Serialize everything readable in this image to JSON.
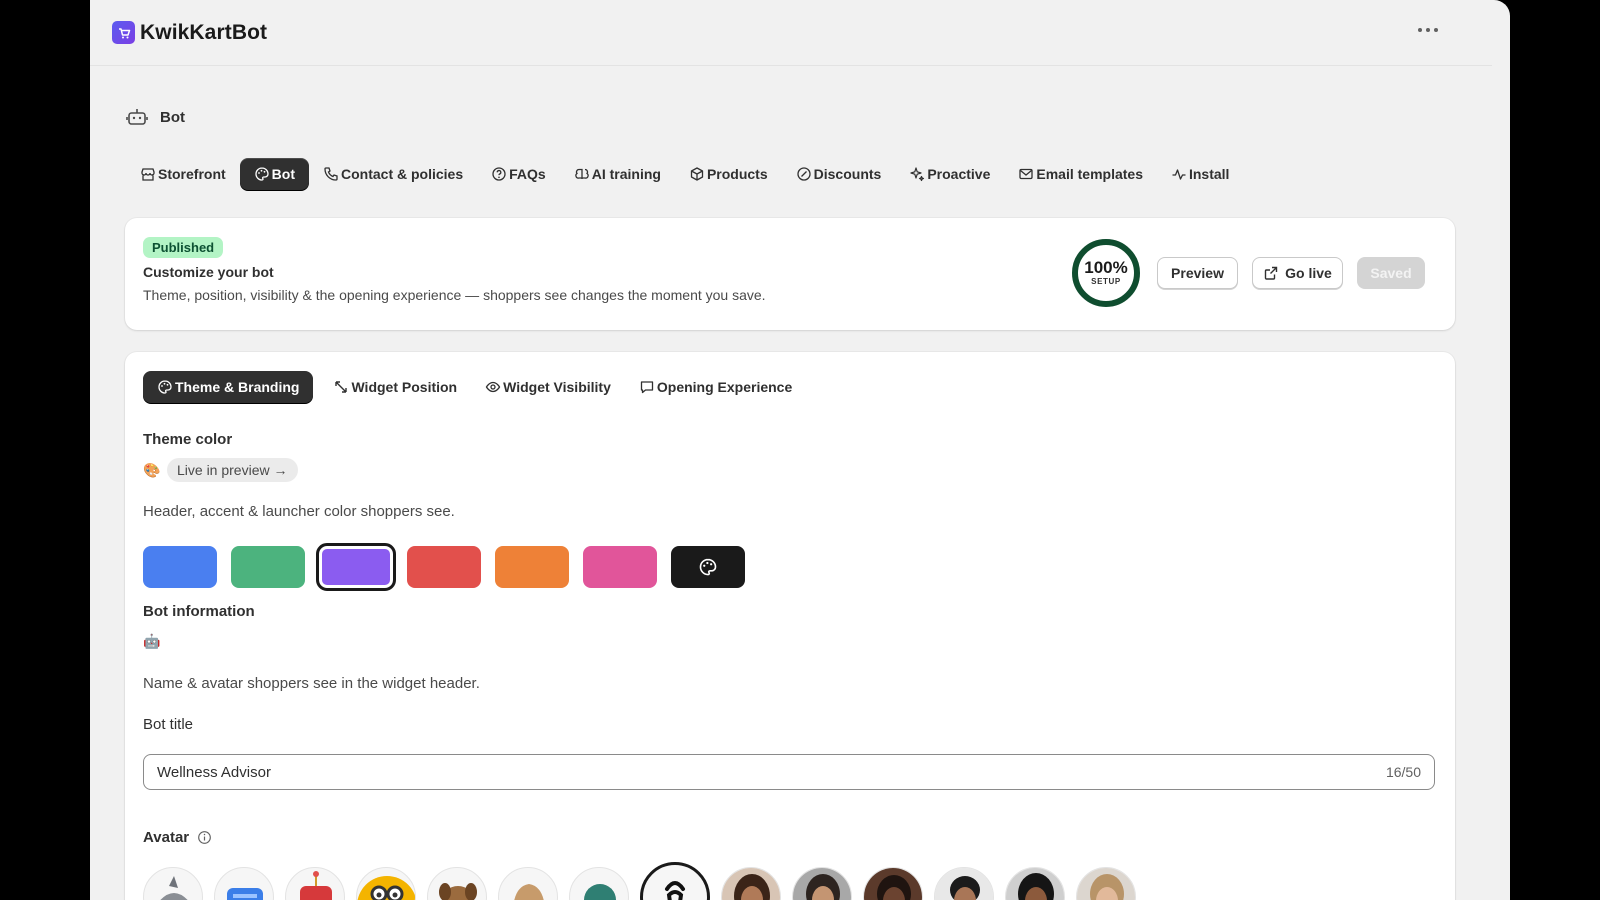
{
  "app": {
    "title": "KwikKartBot"
  },
  "page": {
    "title": "Bot"
  },
  "nav": {
    "items": [
      {
        "label": "Storefront"
      },
      {
        "label": "Bot"
      },
      {
        "label": "Contact & policies"
      },
      {
        "label": "FAQs"
      },
      {
        "label": "AI training"
      },
      {
        "label": "Products"
      },
      {
        "label": "Discounts"
      },
      {
        "label": "Proactive"
      },
      {
        "label": "Email templates"
      },
      {
        "label": "Install"
      }
    ],
    "active": "Bot"
  },
  "status_card": {
    "badge": "Published",
    "title": "Customize your bot",
    "description": "Theme, position, visibility & the opening experience — shoppers see changes the moment you save.",
    "setup_progress": "100%",
    "setup_label": "SETUP",
    "setup_fraction": 1.0,
    "preview_button": "Preview",
    "golive_button": "Go live",
    "saved_button": "Saved"
  },
  "subtabs": {
    "items": [
      {
        "label": "Theme & Branding"
      },
      {
        "label": "Widget Position"
      },
      {
        "label": "Widget Visibility"
      },
      {
        "label": "Opening Experience"
      }
    ],
    "active": "Theme & Branding"
  },
  "theme": {
    "title": "Theme color",
    "emoji": "🎨",
    "chip": "Live in preview →",
    "help": "Header, accent & launcher color shoppers see.",
    "swatches": [
      {
        "color": "#4a7ff0",
        "name": "blue"
      },
      {
        "color": "#4cb37e",
        "name": "green"
      },
      {
        "color": "#8b5cf0",
        "name": "purple",
        "selected": true
      },
      {
        "color": "#e2504c",
        "name": "red"
      },
      {
        "color": "#ee8137",
        "name": "orange"
      },
      {
        "color": "#e1559a",
        "name": "pink"
      },
      {
        "color": "#1a1a1a",
        "name": "custom"
      }
    ]
  },
  "bot_info": {
    "title": "Bot information",
    "emoji": "🤖",
    "help": "Name & avatar shoppers see in the widget header.",
    "bot_title_label": "Bot title",
    "bot_title_value": "Wellness Advisor",
    "bot_title_counter": "16/50",
    "avatar_label": "Avatar",
    "avatars": [
      "shark",
      "robot-blue",
      "robot-red",
      "glasses-emoji",
      "dog",
      "hand",
      "teal-avatar",
      "selected-logo",
      "person-1",
      "person-2",
      "person-3",
      "person-4",
      "person-5",
      "person-6"
    ]
  }
}
